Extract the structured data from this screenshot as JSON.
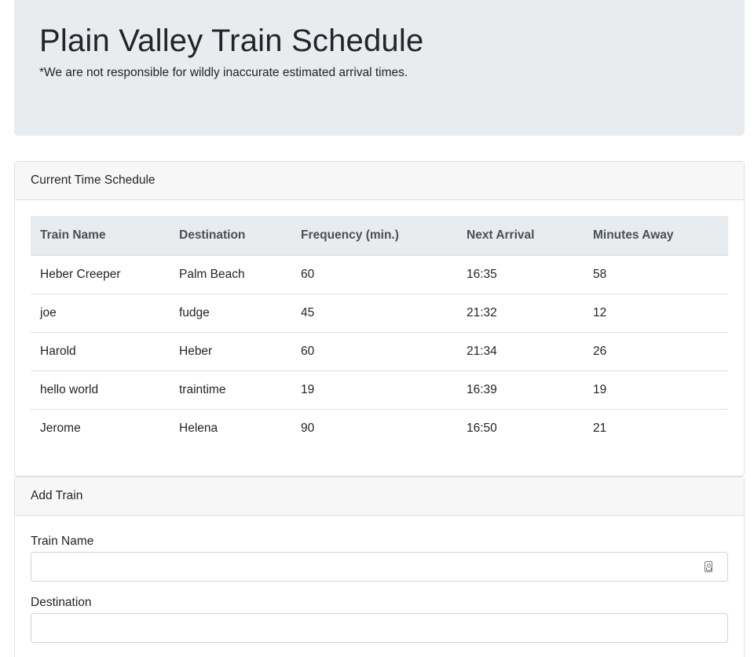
{
  "header": {
    "title": "Plain Valley Train Schedule",
    "disclaimer": "*We are not responsible for wildly inaccurate estimated arrival times."
  },
  "schedule": {
    "card_title": "Current Time Schedule",
    "columns": [
      "Train Name",
      "Destination",
      "Frequency (min.)",
      "Next Arrival",
      "Minutes Away"
    ],
    "rows": [
      [
        "Heber Creeper",
        "Palm Beach",
        "60",
        "16:35",
        "58"
      ],
      [
        "joe",
        "fudge",
        "45",
        "21:32",
        "12"
      ],
      [
        "Harold",
        "Heber",
        "60",
        "21:34",
        "26"
      ],
      [
        "hello world",
        "traintime",
        "19",
        "16:39",
        "19"
      ],
      [
        "Jerome",
        "Helena",
        "90",
        "16:50",
        "21"
      ]
    ]
  },
  "add_train": {
    "card_title": "Add Train",
    "train_name_label": "Train Name",
    "train_name_value": "",
    "destination_label": "Destination",
    "destination_value": ""
  }
}
